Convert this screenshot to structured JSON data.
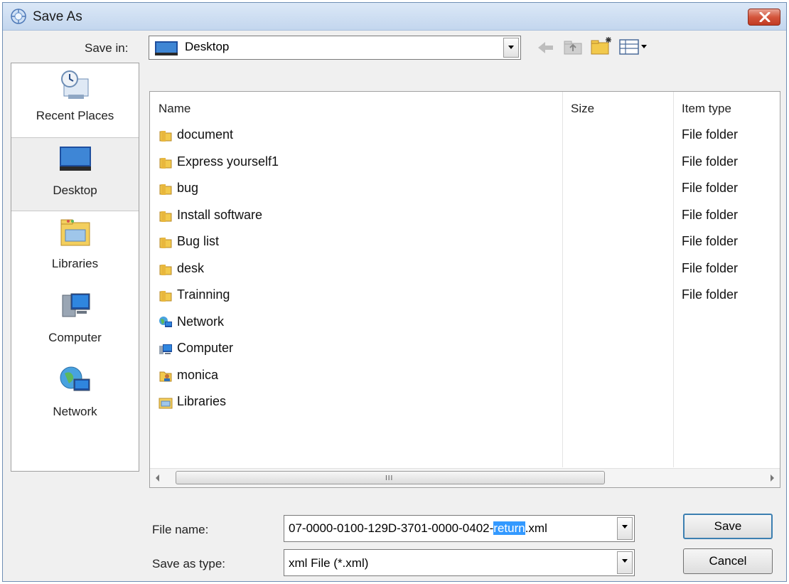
{
  "window": {
    "title": "Save As"
  },
  "save_in": {
    "label": "Save in:",
    "value": "Desktop"
  },
  "places": [
    {
      "label": "Recent Places",
      "icon": "recent-places-icon"
    },
    {
      "label": "Desktop",
      "icon": "desktop-icon",
      "selected": true
    },
    {
      "label": "Libraries",
      "icon": "libraries-icon"
    },
    {
      "label": "Computer",
      "icon": "computer-icon"
    },
    {
      "label": "Network",
      "icon": "network-icon"
    }
  ],
  "columns": {
    "name": "Name",
    "size": "Size",
    "type": "Item type"
  },
  "files": [
    {
      "name": "document",
      "type": "File folder",
      "icon": "folder-icon"
    },
    {
      "name": "Express yourself1",
      "type": "File folder",
      "icon": "folder-icon"
    },
    {
      "name": "bug",
      "type": "File folder",
      "icon": "folder-icon"
    },
    {
      "name": "Install software",
      "type": "File folder",
      "icon": "folder-icon"
    },
    {
      "name": "Bug list",
      "type": "File folder",
      "icon": "folder-icon"
    },
    {
      "name": "desk",
      "type": "File folder",
      "icon": "folder-icon"
    },
    {
      "name": "Trainning",
      "type": "File folder",
      "icon": "folder-icon"
    },
    {
      "name": "Network",
      "type": "",
      "icon": "network-icon"
    },
    {
      "name": "Computer",
      "type": "",
      "icon": "computer-icon"
    },
    {
      "name": "monica",
      "type": "",
      "icon": "user-folder-icon"
    },
    {
      "name": "Libraries",
      "type": "",
      "icon": "libraries-icon"
    }
  ],
  "file_name": {
    "label": "File name:",
    "prefix": "07-0000-0100-129D-3701-0000-0402-",
    "selected": "return",
    "suffix": ".xml"
  },
  "save_as_type": {
    "label": "Save as type:",
    "value": "xml File (*.xml)"
  },
  "buttons": {
    "save": "Save",
    "cancel": "Cancel"
  },
  "colors": {
    "accent": "#3399ff",
    "close": "#c94a31",
    "folder": "#e8b73d"
  }
}
